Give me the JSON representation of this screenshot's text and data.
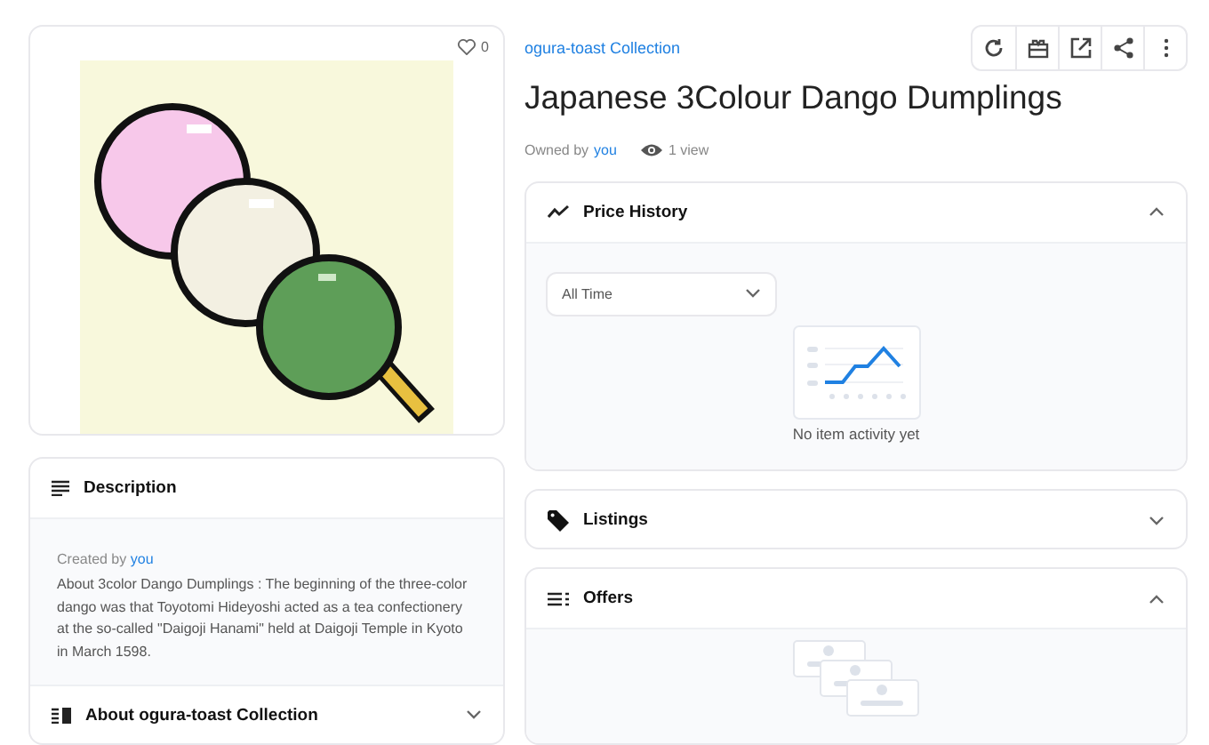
{
  "item_card": {
    "likes": "0"
  },
  "description": {
    "title": "Description",
    "created_by_label": "Created by",
    "creator": "you",
    "text": "About 3color Dango Dumplings : The beginning of the three-color dango was that Toyotomi Hideyoshi acted as a tea confectionery at the so-called \"Daigoji Hanami\" held at Daigoji Temple in Kyoto in March 1598."
  },
  "about": {
    "title": "About ogura-toast Collection",
    "expanded": false
  },
  "collection_link": "ogura-toast Collection",
  "title": "Japanese 3Colour Dango Dumplings",
  "owner": {
    "label": "Owned by",
    "name": "you",
    "views": "1 view"
  },
  "toolbar": [
    {
      "kind": "refresh"
    },
    {
      "kind": "gift"
    },
    {
      "kind": "external"
    },
    {
      "kind": "share"
    },
    {
      "kind": "more"
    }
  ],
  "panels": [
    {
      "kind": "price",
      "title": "Price History",
      "expanded": true,
      "filter": "All Time",
      "empty_text": "No item activity yet"
    },
    {
      "kind": "listings",
      "title": "Listings",
      "expanded": false
    },
    {
      "kind": "offers",
      "title": "Offers",
      "expanded": true
    }
  ]
}
